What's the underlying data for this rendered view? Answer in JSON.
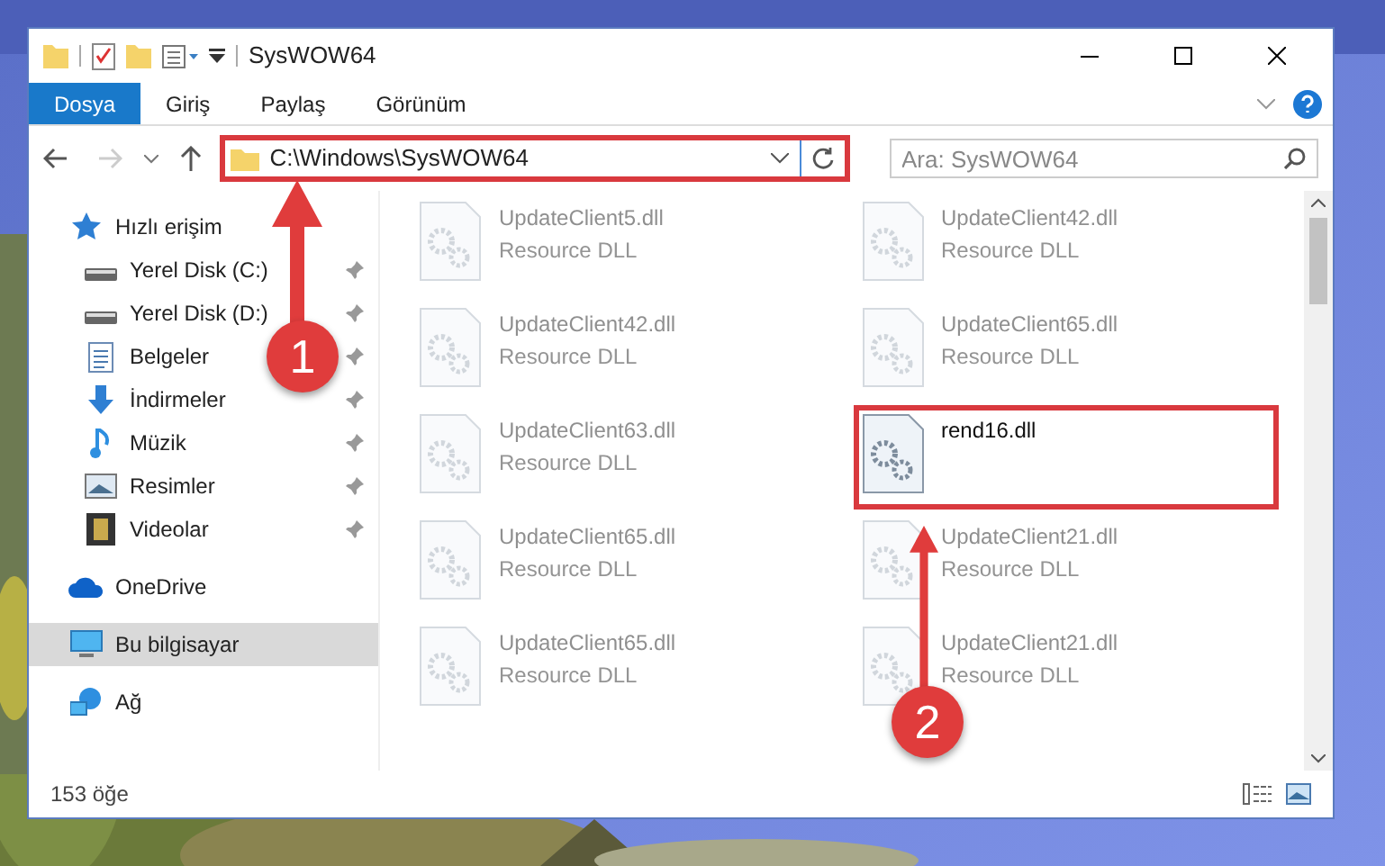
{
  "window": {
    "title": "SysWOW64"
  },
  "ribbon_tabs": [
    {
      "label": "Dosya",
      "selected": true
    },
    {
      "label": "Giriş",
      "selected": false
    },
    {
      "label": "Paylaş",
      "selected": false
    },
    {
      "label": "Görünüm",
      "selected": false
    }
  ],
  "address_bar": {
    "path": "C:\\Windows\\SysWOW64",
    "highlighted": true
  },
  "search": {
    "placeholder": "Ara: SysWOW64"
  },
  "sidebar": {
    "items": [
      {
        "label": "Hızlı erişim",
        "kind": "star",
        "selected": false,
        "pinned": false,
        "children": [
          {
            "label": "Yerel Disk (C:)",
            "kind": "disk",
            "selected": false,
            "pinned": true
          },
          {
            "label": "Yerel Disk (D:)",
            "kind": "disk",
            "selected": false,
            "pinned": true
          },
          {
            "label": "Belgeler",
            "kind": "doc",
            "selected": false,
            "pinned": true
          },
          {
            "label": "İndirmeler",
            "kind": "download",
            "selected": false,
            "pinned": true
          },
          {
            "label": "Müzik",
            "kind": "music",
            "selected": false,
            "pinned": true
          },
          {
            "label": "Resimler",
            "kind": "pictures",
            "selected": false,
            "pinned": true
          },
          {
            "label": "Videolar",
            "kind": "video",
            "selected": false,
            "pinned": true
          }
        ]
      },
      {
        "label": "OneDrive",
        "kind": "cloud",
        "selected": false,
        "pinned": false
      },
      {
        "label": "Bu bilgisayar",
        "kind": "pc",
        "selected": true,
        "pinned": false
      },
      {
        "label": "Ağ",
        "kind": "network",
        "selected": false,
        "pinned": false
      }
    ]
  },
  "files": [
    {
      "name": "UpdateClient5.dll",
      "type": "Resource DLL",
      "faded": true,
      "highlighted": false
    },
    {
      "name": "UpdateClient42.dll",
      "type": "Resource DLL",
      "faded": true,
      "highlighted": false
    },
    {
      "name": "UpdateClient42.dll",
      "type": "Resource DLL",
      "faded": true,
      "highlighted": false
    },
    {
      "name": "UpdateClient65.dll",
      "type": "Resource DLL",
      "faded": true,
      "highlighted": false
    },
    {
      "name": "UpdateClient63.dll",
      "type": "Resource DLL",
      "faded": true,
      "highlighted": false
    },
    {
      "name": "rend16.dll",
      "faded": false,
      "highlighted": true
    },
    {
      "name": "UpdateClient65.dll",
      "type": "Resource DLL",
      "faded": true,
      "highlighted": false
    },
    {
      "name": "UpdateClient21.dll",
      "type": "Resource DLL",
      "faded": true,
      "highlighted": false
    },
    {
      "name": "UpdateClient65.dll",
      "type": "Resource DLL",
      "faded": true,
      "highlighted": false
    },
    {
      "name": "UpdateClient21.dll",
      "type": "Resource DLL",
      "faded": true,
      "highlighted": false
    }
  ],
  "status_bar": {
    "item_count": "153 öğe"
  },
  "callouts": [
    {
      "label": "1"
    },
    {
      "label": "2"
    }
  ]
}
